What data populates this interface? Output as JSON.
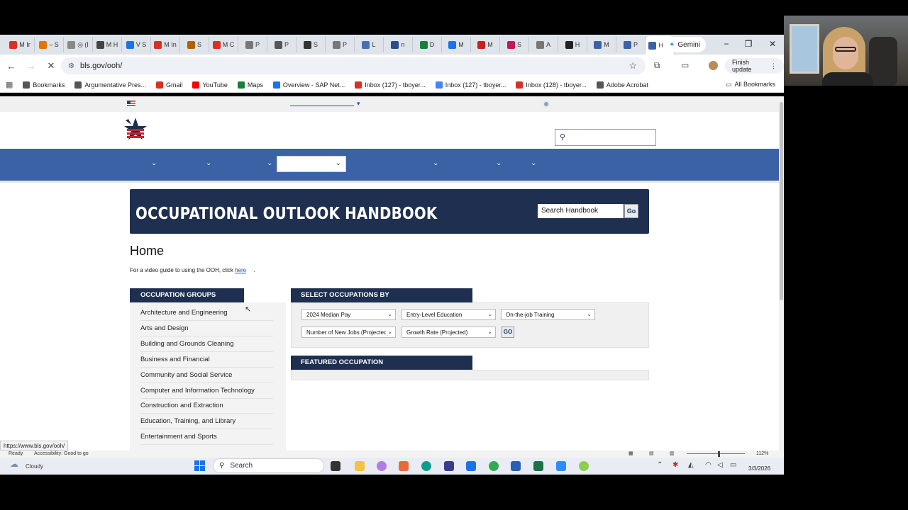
{
  "browser": {
    "tabs": [
      {
        "label": "M Ir",
        "color": "#d93025"
      },
      {
        "label": "– S",
        "color": "#e37400"
      },
      {
        "label": "◎ (I",
        "color": "#888888"
      },
      {
        "label": "M H",
        "color": "#444444"
      },
      {
        "label": "V S",
        "color": "#1a73e8"
      },
      {
        "label": "M In",
        "color": "#d93025"
      },
      {
        "label": "S",
        "color": "#b06000"
      },
      {
        "label": "M C",
        "color": "#d93025"
      },
      {
        "label": "P",
        "color": "#777777"
      },
      {
        "label": "P",
        "color": "#555555"
      },
      {
        "label": "S",
        "color": "#333333"
      },
      {
        "label": "P",
        "color": "#777777"
      },
      {
        "label": "L",
        "color": "#4a6fb3"
      },
      {
        "label": "n",
        "color": "#2b4b8c"
      },
      {
        "label": "D",
        "color": "#188038"
      },
      {
        "label": "M",
        "color": "#1a73e8"
      },
      {
        "label": "M",
        "color": "#c5221f"
      },
      {
        "label": "S",
        "color": "#c2185b"
      },
      {
        "label": "A",
        "color": "#777777"
      },
      {
        "label": "H",
        "color": "#222222"
      },
      {
        "label": "M",
        "color": "#3b62a5"
      },
      {
        "label": "P",
        "color": "#3b62a5"
      },
      {
        "label": "H",
        "color": "#3b62a5",
        "active": true
      }
    ],
    "new_tab": "+",
    "gemini_label": "Gemini",
    "url": "bls.gov/ooh/",
    "finish_update": "Finish update",
    "bookmarks": [
      {
        "label": "Bookmarks",
        "color": "#555555"
      },
      {
        "label": "Argumentative Pres...",
        "color": "#555555"
      },
      {
        "label": "Gmail",
        "color": "#d93025"
      },
      {
        "label": "YouTube",
        "color": "#ff0000"
      },
      {
        "label": "Maps",
        "color": "#188038"
      },
      {
        "label": "Overview - SAP Net...",
        "color": "#1a73e8"
      },
      {
        "label": "Inbox (127) - tboyer...",
        "color": "#d93025"
      },
      {
        "label": "Inbox (127) - tboyer...",
        "color": "#4285f4"
      },
      {
        "label": "Inbox (128) - tboyer...",
        "color": "#d93025"
      },
      {
        "label": "Adobe Acrobat",
        "color": "#555555"
      }
    ],
    "all_bookmarks": "All Bookmarks",
    "status_url": "https://www.bls.gov/ooh/"
  },
  "site": {
    "banner_title": "OCCUPATIONAL OUTLOOK HANDBOOK",
    "search_placeholder": "Search Handbook",
    "search_go": "Go",
    "home_title": "Home",
    "video_guide_text": "For a video guide to using the OOH, click",
    "video_guide_link": "here",
    "video_guide_end": ".",
    "occupation_groups_title": "OCCUPATION GROUPS",
    "occupation_groups": [
      "Architecture and Engineering",
      "Arts and Design",
      "Building and Grounds Cleaning",
      "Business and Financial",
      "Community and Social Service",
      "Computer and Information Technology",
      "Construction and Extraction",
      "Education, Training, and Library",
      "Entertainment and Sports"
    ],
    "select_title": "SELECT OCCUPATIONS BY",
    "selects": [
      "2024 Median Pay",
      "Entry-Level Education",
      "On-the-job Training",
      "Number of New Jobs (Projected)",
      "Growth Rate (Projected)"
    ],
    "select_go": "GO",
    "featured_title": "FEATURED OCCUPATION",
    "brand_blue": "#3b62a5",
    "navy": "#1e2f50"
  },
  "statusbar": {
    "ready": "Ready",
    "accessibility": "Accessibility: Good to go",
    "zoom": "112%"
  },
  "taskbar": {
    "weather": "Cloudy",
    "search": "Search",
    "date": "3/3/2026"
  }
}
